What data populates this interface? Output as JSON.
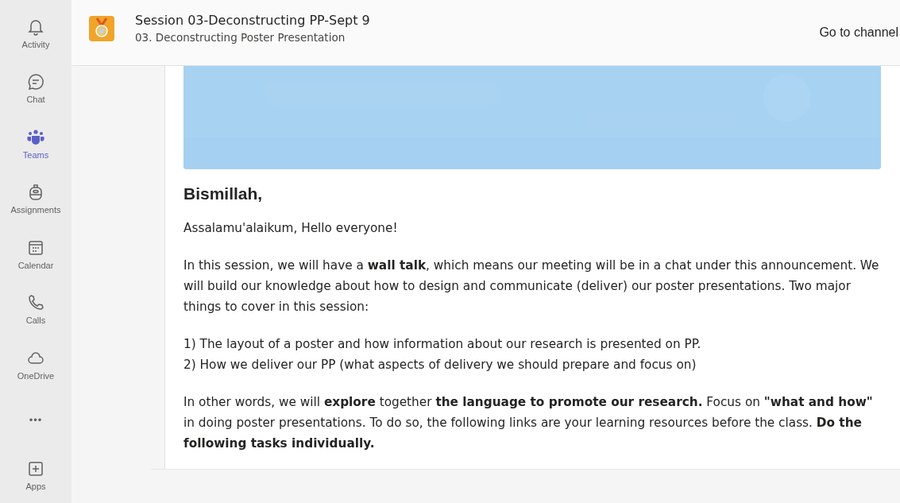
{
  "rail": {
    "items": [
      {
        "label": "Activity",
        "selected": false
      },
      {
        "label": "Chat",
        "selected": false
      },
      {
        "label": "Teams",
        "selected": true
      },
      {
        "label": "Assignments",
        "selected": false
      },
      {
        "label": "Calendar",
        "selected": false
      },
      {
        "label": "Calls",
        "selected": false
      },
      {
        "label": "OneDrive",
        "selected": false
      },
      {
        "label": "•••",
        "selected": false
      },
      {
        "label": "Apps",
        "selected": false
      }
    ]
  },
  "header": {
    "title": "Session 03-Deconstructing PP-Sept 9",
    "subtitle": "03. Deconstructing Poster Presentation",
    "action": "Go to channel"
  },
  "post": {
    "banner": {
      "kind": "picture"
    },
    "heading": "Bismillah,",
    "paragraphs": [
      [
        "Assalamu'alaikum, Hello everyone!"
      ],
      [
        "In this session, we will have a **wall talk**, which means our meeting will be in a chat under this announcement.  We will build our knowledge about how to design and communicate (deliver) our poster presentations. Two major things to cover in this session:"
      ],
      [
        "1) The layout of a poster and how information about our research is presented on PP.",
        "2) How we deliver our PP (what aspects of delivery we should prepare and focus on)"
      ],
      [
        "In other words, we will **explore** together **the language to promote our research.** Focus on  **\"what and how\"** in doing poster presentations. To do so, the following links are your learning resources before the class. **Do the following tasks individually.**"
      ]
    ]
  }
}
